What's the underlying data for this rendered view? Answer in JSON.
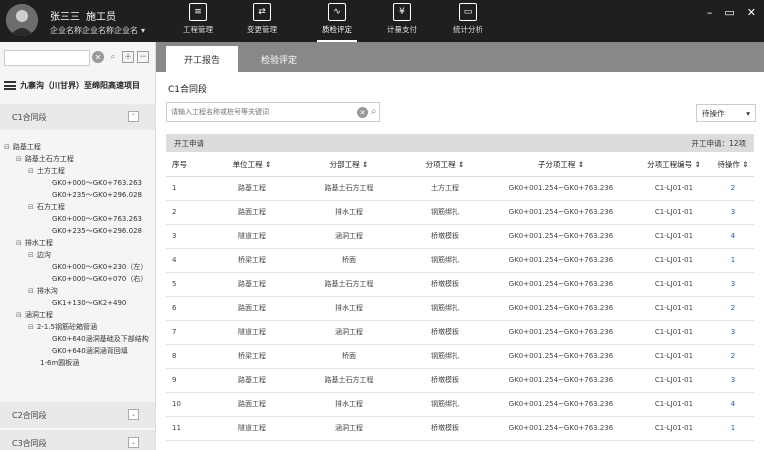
{
  "user": {
    "name": "张三三",
    "role": "施工员",
    "company": "企业名称企业名称企业名"
  },
  "nav": [
    {
      "label": "工程管理",
      "icon": "document-icon"
    },
    {
      "label": "变更管理",
      "icon": "swap-icon"
    },
    {
      "label": "质检评定",
      "icon": "chart-icon"
    },
    {
      "label": "计量支付",
      "icon": "payment-icon"
    },
    {
      "label": "统计分析",
      "icon": "monitor-icon"
    }
  ],
  "window_controls": [
    "–",
    "▭",
    "✕"
  ],
  "left": {
    "project": "九寨沟（川甘界）至绵阳高速项目",
    "sections": [
      "C1合同段",
      "C2合同段",
      "C3合同段"
    ],
    "tree": [
      "路基工程",
      "路基土石方工程",
      "土方工程",
      "GK0+000～GK0+763.263",
      "GK0+235～GK0+296.028",
      "石方工程",
      "GK0+000～GK0+763.263",
      "GK0+235～GK0+296.028",
      "排水工程",
      "边沟",
      "GK0+000～GK0+230（左）",
      "GK0+000～GK0+070（右）",
      "排水沟",
      "GK1+130～GK2+490",
      "涵洞工程",
      "2-1.5钢筋砼箱管涵",
      "GK0+640涵洞基础及下部结构",
      "GK0+640涵洞涵背回填",
      "1-6m圆板涵"
    ]
  },
  "main": {
    "tabs": [
      "开工报告",
      "检验评定"
    ],
    "contract": "C1合同段",
    "search_placeholder": "请输入工程名称或桩号等关键词",
    "op_select": "待操作",
    "subhead_left": "开工申请",
    "subhead_right": "开工申请：12项",
    "columns": [
      "序号",
      "单位工程 ⇕",
      "分部工程 ⇕",
      "分项工程 ⇕",
      "子分项工程 ⇕",
      "分项工程编号 ⇕",
      "待操作 ⇕"
    ],
    "rows": [
      [
        "1",
        "路基工程",
        "路基土石方工程",
        "土方工程",
        "GK0+001.254~GK0+763.236",
        "C1-LJ01-01",
        "2"
      ],
      [
        "2",
        "路面工程",
        "排水工程",
        "钢筋绑扎",
        "GK0+001.254~GK0+763.236",
        "C1-LJ01-01",
        "3"
      ],
      [
        "3",
        "隧道工程",
        "涵洞工程",
        "桥墩模板",
        "GK0+001.254~GK0+763.236",
        "C1-LJ01-01",
        "4"
      ],
      [
        "4",
        "桥梁工程",
        "桥面",
        "钢筋绑扎",
        "GK0+001.254~GK0+763.236",
        "C1-LJ01-01",
        "1"
      ],
      [
        "5",
        "路基工程",
        "路基土石方工程",
        "桥墩模板",
        "GK0+001.254~GK0+763.236",
        "C1-LJ01-01",
        "3"
      ],
      [
        "6",
        "路面工程",
        "排水工程",
        "钢筋绑扎",
        "GK0+001.254~GK0+763.236",
        "C1-LJ01-01",
        "2"
      ],
      [
        "7",
        "隧道工程",
        "涵洞工程",
        "桥墩模板",
        "GK0+001.254~GK0+763.236",
        "C1-LJ01-01",
        "3"
      ],
      [
        "8",
        "桥梁工程",
        "桥面",
        "钢筋绑扎",
        "GK0+001.254~GK0+763.236",
        "C1-LJ01-01",
        "2"
      ],
      [
        "9",
        "路基工程",
        "路基土石方工程",
        "桥墩模板",
        "GK0+001.254~GK0+763.236",
        "C1-LJ01-01",
        "3"
      ],
      [
        "10",
        "路面工程",
        "排水工程",
        "钢筋绑扎",
        "GK0+001.254~GK0+763.236",
        "C1-LJ01-01",
        "4"
      ],
      [
        "11",
        "隧道工程",
        "涵洞工程",
        "桥墩模板",
        "GK0+001.254~GK0+763.236",
        "C1-LJ01-01",
        "1"
      ]
    ]
  }
}
